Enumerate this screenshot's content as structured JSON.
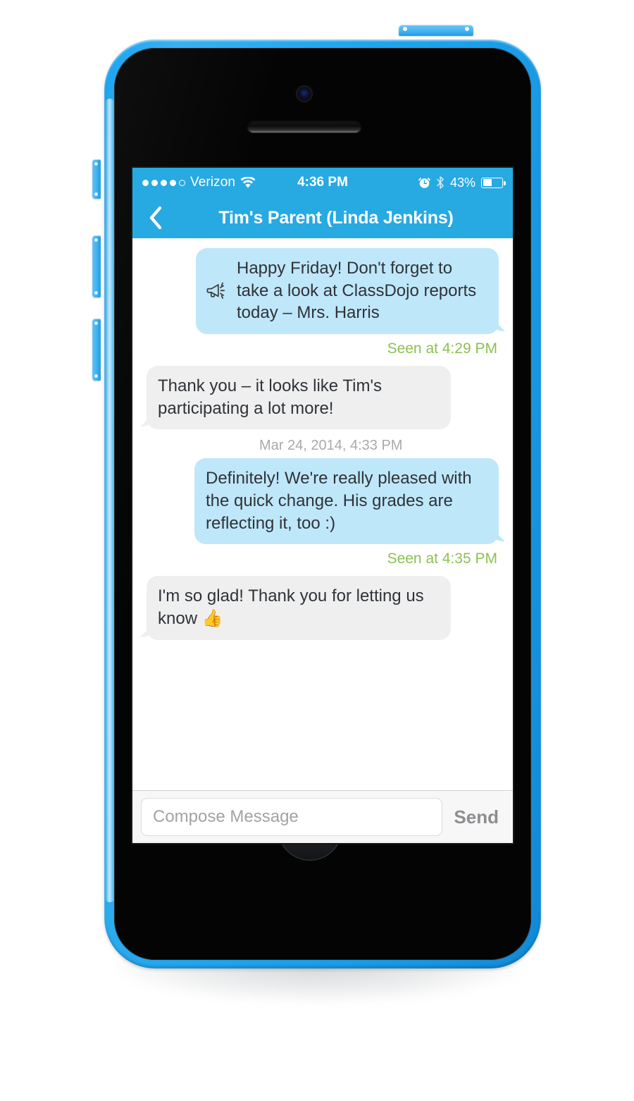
{
  "device": {
    "name": "iPhone 5c",
    "body_color": "#27a9e1",
    "front_color": "#040404",
    "hardware": {
      "camera": "camera-lens",
      "earpiece": "earpiece-speaker",
      "home_button": "home-button",
      "power_button": "power-button",
      "silent_switch": "silent-switch",
      "volume_up": "volume-up-button",
      "volume_down": "volume-down-button"
    }
  },
  "status_bar": {
    "carrier": "Verizon",
    "signal_filled": 4,
    "signal_total": 5,
    "wifi_icon": "wifi-icon",
    "time": "4:36 PM",
    "alarm_icon": "alarm-clock-icon",
    "bluetooth_icon": "bluetooth-icon",
    "battery_percent": "43%",
    "battery_level": 43,
    "background": "#27a9e1",
    "foreground": "#ffffff"
  },
  "nav_bar": {
    "back_icon": "chevron-left-icon",
    "title": "Tim's Parent (Linda Jenkins)",
    "background": "#27a9e1"
  },
  "colors": {
    "accent_blue": "#27a9e1",
    "outgoing_bubble": "#bfe7fa",
    "incoming_bubble": "#efeff0",
    "seen_green": "#8cc152",
    "timestamp_gray": "#a9aaad",
    "body_text": "#2f3337"
  },
  "conversation": {
    "items": [
      {
        "kind": "message",
        "direction": "outgoing",
        "icon": "megaphone-icon",
        "text": "Happy Friday! Don't forget to take a look at ClassDojo reports today – Mrs. Harris"
      },
      {
        "kind": "receipt",
        "text": "Seen at 4:29 PM"
      },
      {
        "kind": "message",
        "direction": "incoming",
        "text": "Thank you – it looks like Tim's participating a lot more!"
      },
      {
        "kind": "daystamp",
        "text": "Mar 24, 2014, 4:33 PM"
      },
      {
        "kind": "message",
        "direction": "outgoing",
        "text": "Definitely! We're really pleased with the quick change. His grades are reflecting it, too :)"
      },
      {
        "kind": "receipt",
        "text": "Seen at 4:35 PM"
      },
      {
        "kind": "message",
        "direction": "incoming",
        "text": "I'm so glad! Thank you for letting us know 👍"
      }
    ]
  },
  "compose": {
    "placeholder": "Compose Message",
    "value": "",
    "send_label": "Send"
  }
}
